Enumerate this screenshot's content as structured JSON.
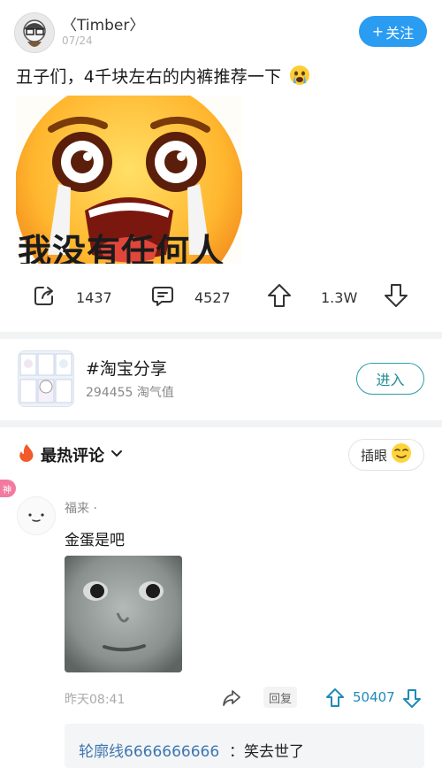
{
  "post": {
    "username": "〈Timber〉",
    "date": "07/24",
    "follow_label": "关注",
    "text": "丑子们，4千块左右的内裤推荐一下",
    "image_caption": "我没有任何人"
  },
  "actions": {
    "share_count": "1437",
    "comment_count": "4527",
    "upvote_count": "1.3W"
  },
  "topic": {
    "title": "#淘宝分享",
    "meta": "294455 淘气值",
    "enter_label": "进入"
  },
  "comments_header": {
    "label": "最热评论",
    "insert_label": "插眼"
  },
  "comment": {
    "tag": "神",
    "username": "福来 ·",
    "text": "金蛋是吧",
    "time": "昨天08:41",
    "reply_label": "回复",
    "likes": "50407"
  },
  "sub_reply": {
    "username": "轮廓线6666666666",
    "text": "：笑去世了"
  },
  "colors": {
    "accent_blue": "#2a9cf2",
    "teal": "#2a9ca5",
    "link_blue": "#3d77b0"
  }
}
